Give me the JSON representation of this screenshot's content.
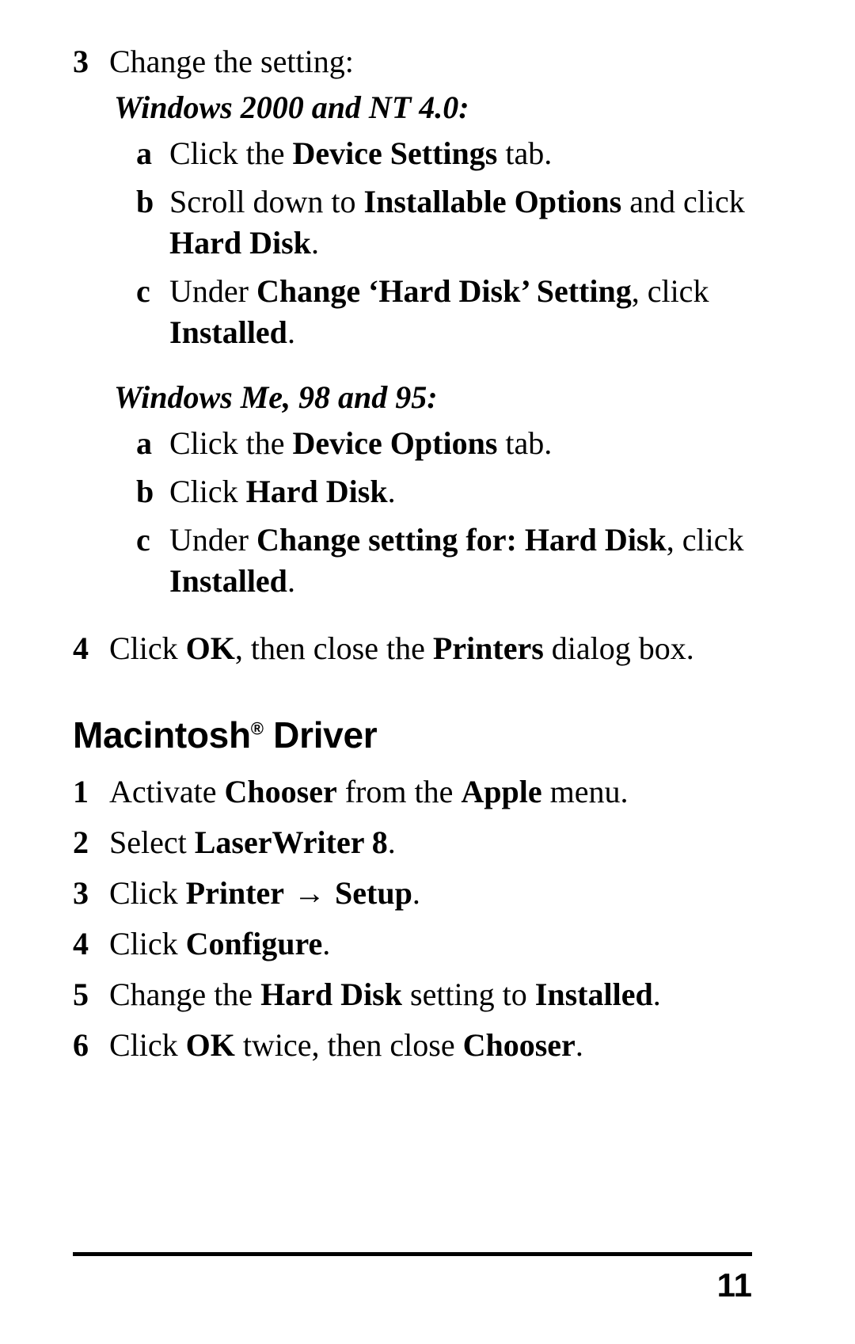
{
  "page": {
    "number": "11"
  },
  "windows_section": {
    "step3": {
      "number": "3",
      "text": "Change the setting:"
    },
    "os_group_1": {
      "heading": "Windows 2000 and NT 4.0:",
      "substeps": [
        {
          "letter": "a",
          "parts": [
            {
              "text": "Click the ",
              "bold": false
            },
            {
              "text": "Device Settings",
              "bold": true
            },
            {
              "text": " tab.",
              "bold": false
            }
          ]
        },
        {
          "letter": "b",
          "parts": [
            {
              "text": "Scroll down to ",
              "bold": false
            },
            {
              "text": "Installable Options",
              "bold": true
            },
            {
              "text": " and click ",
              "bold": false
            },
            {
              "text": "Hard Disk",
              "bold": true
            },
            {
              "text": ".",
              "bold": false
            }
          ]
        },
        {
          "letter": "c",
          "parts": [
            {
              "text": "Under ",
              "bold": false
            },
            {
              "text": "Change ‘Hard Disk’ Setting",
              "bold": true
            },
            {
              "text": ", click ",
              "bold": false
            },
            {
              "text": "Installed",
              "bold": true
            },
            {
              "text": ".",
              "bold": false
            }
          ]
        }
      ]
    },
    "os_group_2": {
      "heading": "Windows Me, 98 and 95:",
      "substeps": [
        {
          "letter": "a",
          "parts": [
            {
              "text": "Click the ",
              "bold": false
            },
            {
              "text": "Device Options",
              "bold": true
            },
            {
              "text": " tab.",
              "bold": false
            }
          ]
        },
        {
          "letter": "b",
          "parts": [
            {
              "text": "Click ",
              "bold": false
            },
            {
              "text": "Hard Disk",
              "bold": true
            },
            {
              "text": ".",
              "bold": false
            }
          ]
        },
        {
          "letter": "c",
          "parts": [
            {
              "text": "Under ",
              "bold": false
            },
            {
              "text": "Change setting for: Hard Disk",
              "bold": true
            },
            {
              "text": ", click ",
              "bold": false
            },
            {
              "text": "Installed",
              "bold": true
            },
            {
              "text": ".",
              "bold": false
            }
          ]
        }
      ]
    },
    "step4": {
      "number": "4",
      "parts": [
        {
          "text": "Click ",
          "bold": false
        },
        {
          "text": "OK",
          "bold": true
        },
        {
          "text": ", then close the ",
          "bold": false
        },
        {
          "text": "Printers",
          "bold": true
        },
        {
          "text": " dialog box.",
          "bold": false
        }
      ]
    }
  },
  "macintosh_section": {
    "heading_text": "Macintosh",
    "heading_reg": "®",
    "heading_suffix": " Driver",
    "steps": [
      {
        "number": "1",
        "parts": [
          {
            "text": "Activate ",
            "bold": false
          },
          {
            "text": "Chooser",
            "bold": true
          },
          {
            "text": " from the ",
            "bold": false
          },
          {
            "text": "Apple",
            "bold": true
          },
          {
            "text": " menu.",
            "bold": false
          }
        ]
      },
      {
        "number": "2",
        "parts": [
          {
            "text": "Select ",
            "bold": false
          },
          {
            "text": "LaserWriter 8",
            "bold": true
          },
          {
            "text": ".",
            "bold": false
          }
        ]
      },
      {
        "number": "3",
        "parts": [
          {
            "text": "Click ",
            "bold": false
          },
          {
            "text": "Printer",
            "bold": true
          },
          {
            "text": " → ",
            "bold": false,
            "arrow": true
          },
          {
            "text": "Setup",
            "bold": true
          },
          {
            "text": ".",
            "bold": false
          }
        ]
      },
      {
        "number": "4",
        "parts": [
          {
            "text": "Click ",
            "bold": false
          },
          {
            "text": "Configure",
            "bold": true
          },
          {
            "text": ".",
            "bold": false
          }
        ]
      },
      {
        "number": "5",
        "parts": [
          {
            "text": "Change the ",
            "bold": false
          },
          {
            "text": "Hard Disk",
            "bold": true
          },
          {
            "text": " setting to ",
            "bold": false
          },
          {
            "text": "Installed",
            "bold": true
          },
          {
            "text": ".",
            "bold": false
          }
        ]
      },
      {
        "number": "6",
        "parts": [
          {
            "text": "Click ",
            "bold": false
          },
          {
            "text": "OK",
            "bold": true
          },
          {
            "text": " twice, then close ",
            "bold": false
          },
          {
            "text": "Chooser",
            "bold": true
          },
          {
            "text": ".",
            "bold": false
          }
        ]
      }
    ]
  }
}
